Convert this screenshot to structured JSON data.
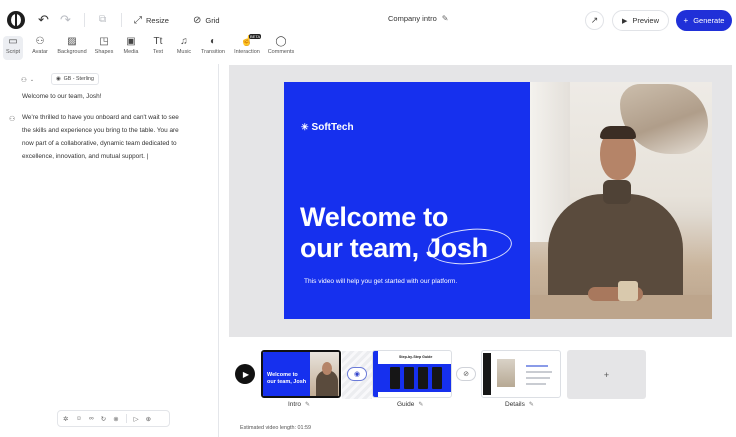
{
  "header": {
    "undo_icon": "undo-icon",
    "redo_icon": "redo-icon",
    "resize_label": "Resize",
    "grid_label": "Grid",
    "project_title": "Company intro",
    "preview_label": "Preview",
    "generate_label": "Generate"
  },
  "tools": [
    {
      "label": "Script",
      "icon": "script-icon"
    },
    {
      "label": "Avatar",
      "icon": "avatar-icon"
    },
    {
      "label": "Background",
      "icon": "background-icon"
    },
    {
      "label": "Shapes",
      "icon": "shapes-icon"
    },
    {
      "label": "Media",
      "icon": "media-icon"
    },
    {
      "label": "Text",
      "icon": "text-icon"
    },
    {
      "label": "Music",
      "icon": "music-icon"
    },
    {
      "label": "Transition",
      "icon": "transition-icon"
    },
    {
      "label": "Interaction",
      "icon": "interaction-icon",
      "badge": "BETA"
    },
    {
      "label": "Comments",
      "icon": "comments-icon"
    }
  ],
  "script": {
    "voice_label": "GB - Sterling",
    "greeting": "Welcome to our team, Josh!",
    "paragraph_lines": [
      "We're thrilled to have you onboard and can't wait to see",
      "the skills and experience you bring to the table. You are",
      "now part of a collaborative, dynamic team dedicated to",
      "excellence, innovation, and mutual support."
    ]
  },
  "slide": {
    "brand": "SoftTech",
    "headline_line1": "Welcome to",
    "headline_line2": "our team, Josh",
    "subline": "This video will help you get started with our platform."
  },
  "timeline": {
    "scenes": [
      {
        "label": "Intro",
        "thumb_headline_1": "Welcome to",
        "thumb_headline_2": "our team, Josh"
      },
      {
        "label": "Guide",
        "thumb_title": "Step-by-Step Guide"
      },
      {
        "label": "Details"
      }
    ],
    "add_slide_symbol": "+",
    "estimated_length": "Estimated video length: 01:59"
  },
  "colors": {
    "accent": "#2030d8",
    "slide_blue": "#1630ee"
  }
}
